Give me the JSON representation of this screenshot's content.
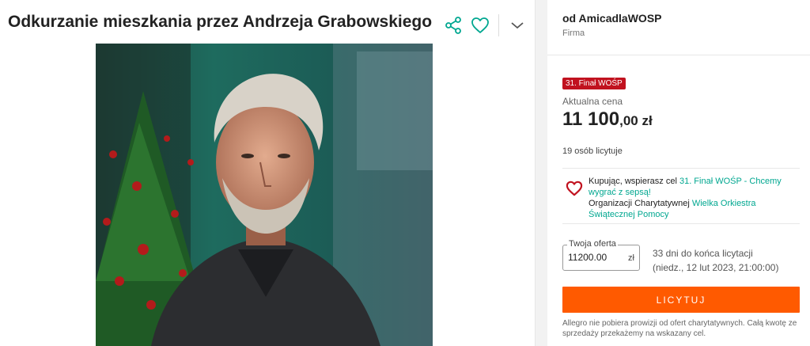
{
  "listing": {
    "title": "Odkurzanie mieszkania przez Andrzeja Grabowskiego",
    "actions": {
      "share_icon": "share-icon",
      "watch_icon": "heart-outline-icon",
      "expand_icon": "chevron-down-icon"
    },
    "photo_alt": "Andrzej Grabowski"
  },
  "seller": {
    "name": "od AmicadlaWOSP",
    "type": "Firma"
  },
  "offer": {
    "badge": "31. Finał WOŚP",
    "price_label": "Aktualna cena",
    "price_main": "11 100",
    "price_decimal": ",00 zł",
    "bidders": "19 osób licytuje",
    "charity": {
      "prefix": "Kupując, wspierasz cel ",
      "goal_link": "31. Finał WOŚP - Chcemy wygrać z sepsą!",
      "org_prefix": "Organizacji Charytatywnej ",
      "org_link": "Wielka Orkiestra Świątecznej Pomocy"
    },
    "bid_field": {
      "legend": "Twoja oferta",
      "value": "11200.00",
      "unit": "zł"
    },
    "time_left": "33 dni do końca licytacji",
    "end_date": "(niedz., 12 lut 2023, 21:00:00)",
    "bid_button": "LICYTUJ",
    "note": "Allegro nie pobiera prowizji od ofert charytatywnych. Całą kwotę ze sprzedaży przekażemy na wskazany cel."
  },
  "colors": {
    "accent": "#00a790",
    "brand_orange": "#ff5a00",
    "badge_red": "#c1121f"
  }
}
